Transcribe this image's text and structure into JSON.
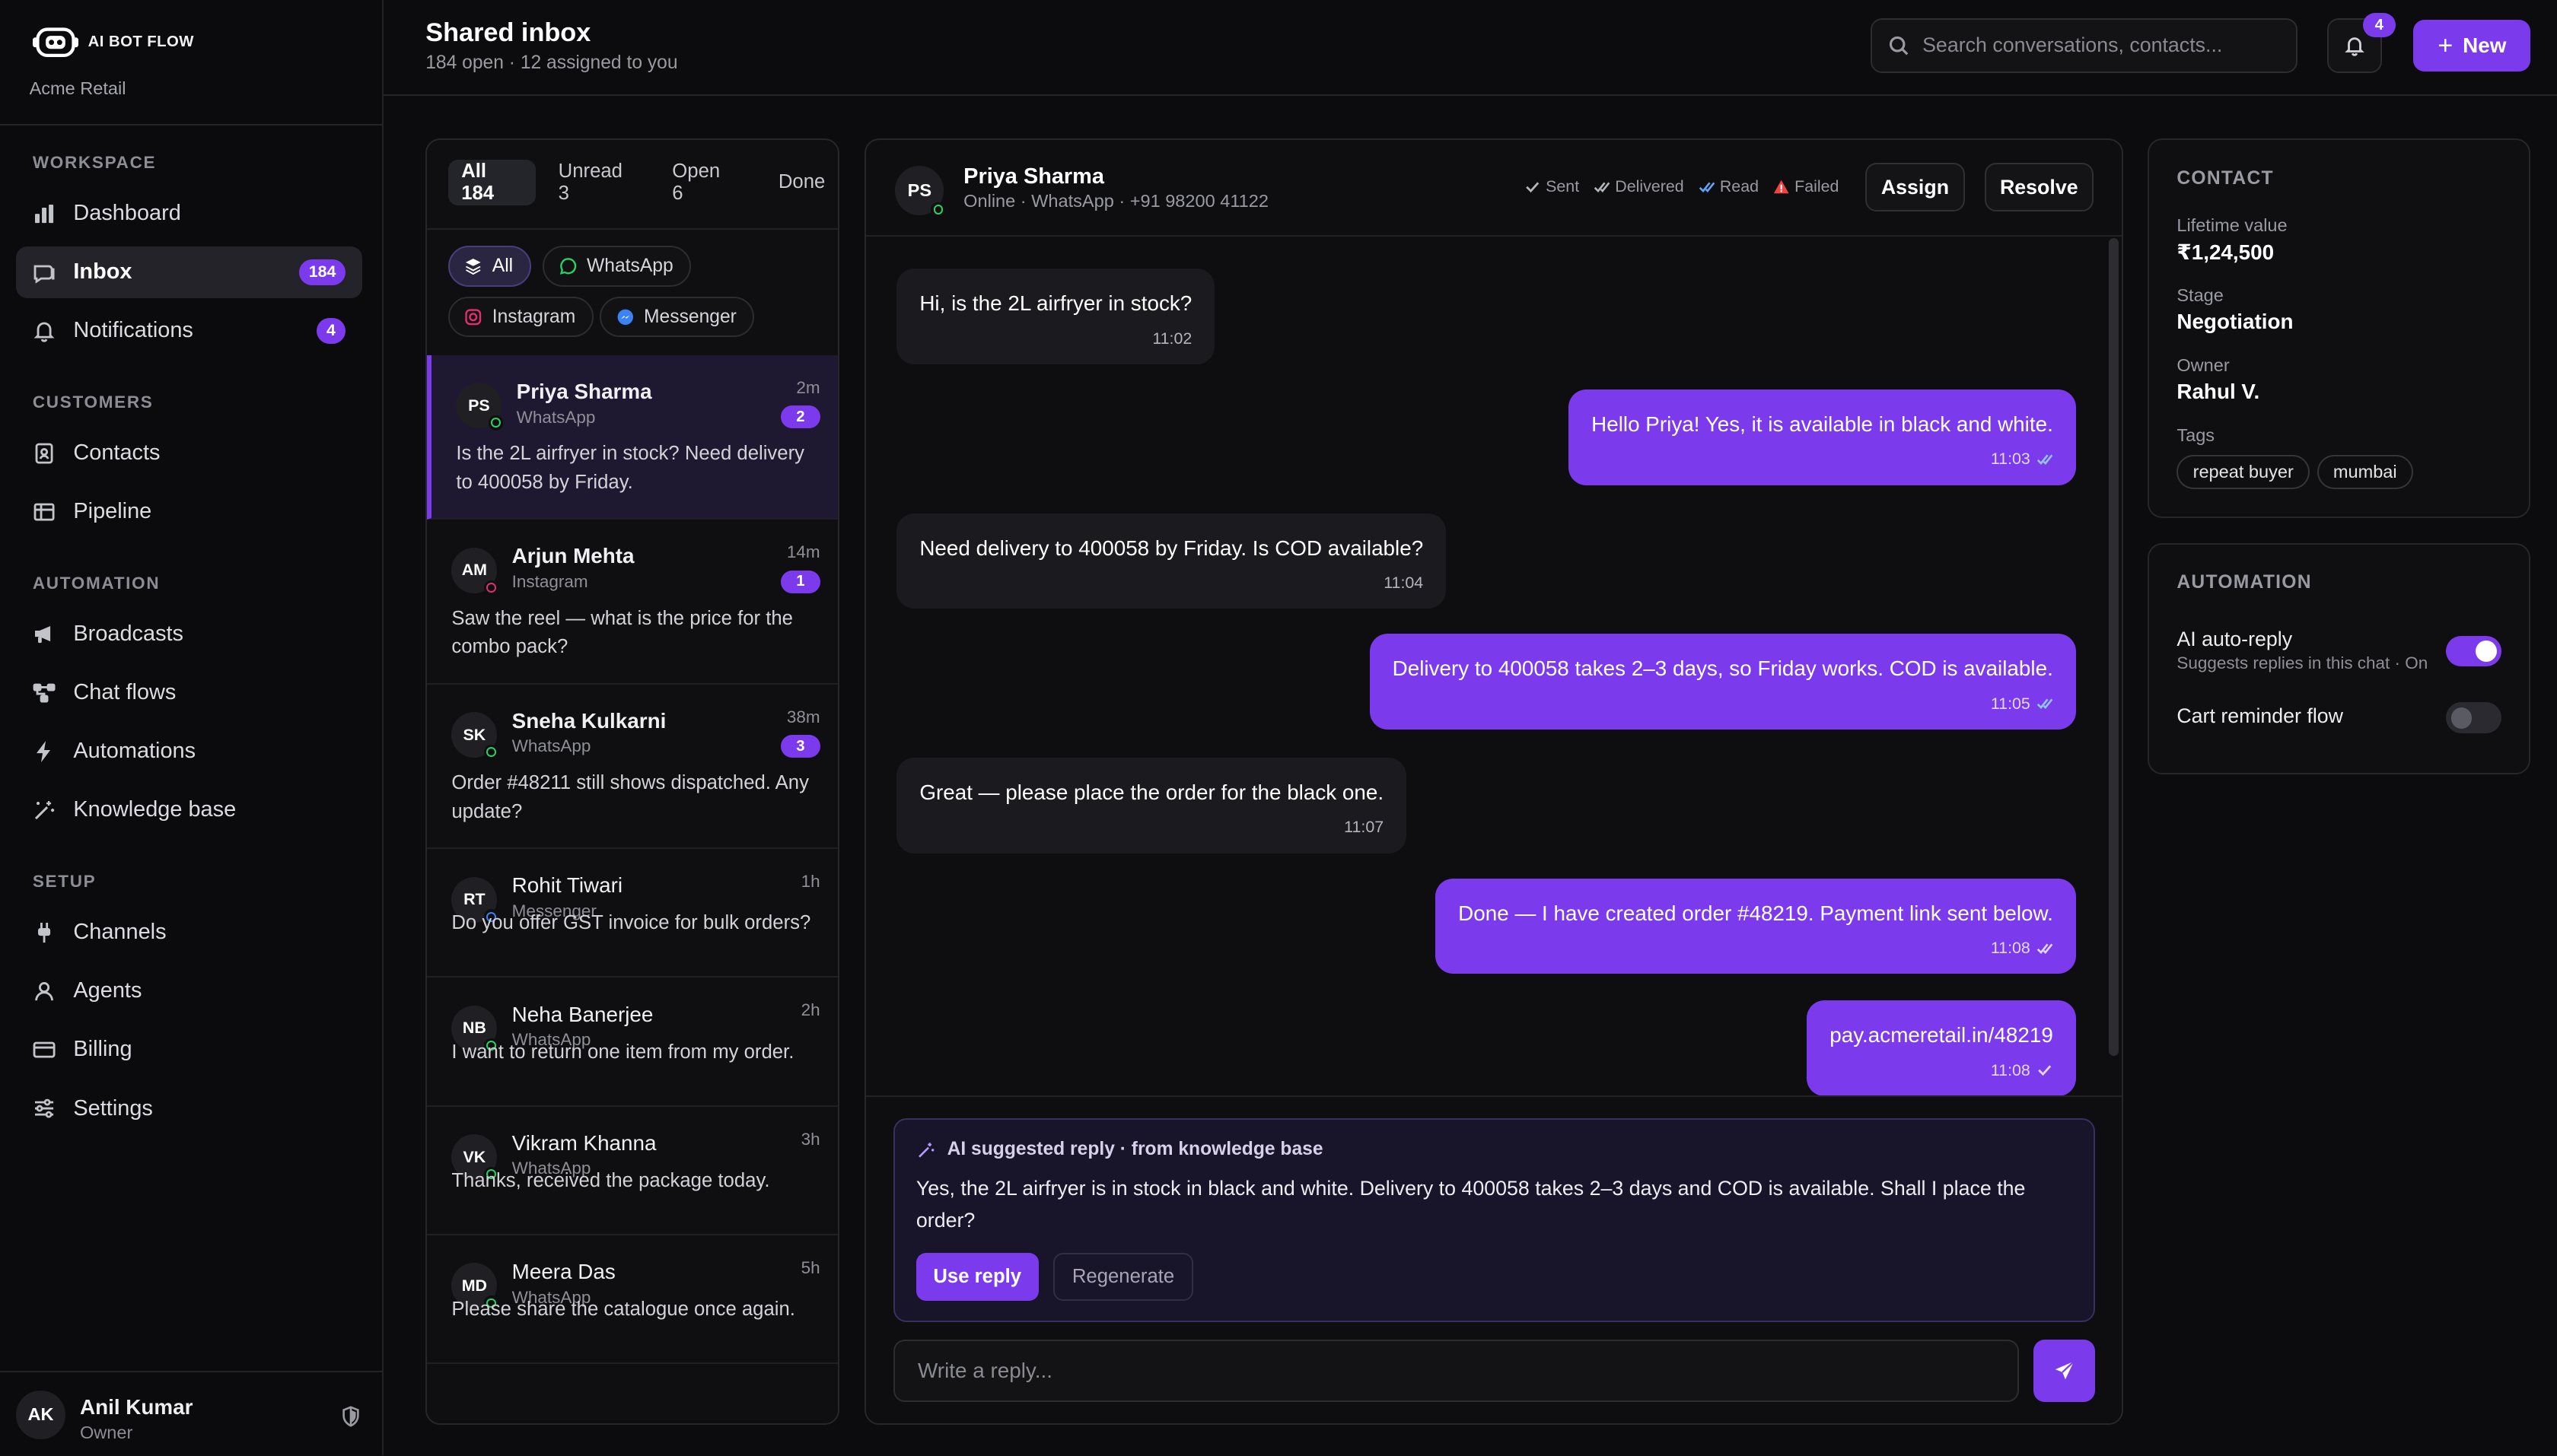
{
  "brand": {
    "name": "AI BOT FLOW",
    "workspace": "Acme Retail"
  },
  "sidebar": {
    "sections": {
      "workspace": "WORKSPACE",
      "customers": "CUSTOMERS",
      "automation": "AUTOMATION",
      "setup": "SETUP"
    },
    "items": [
      {
        "label": "Dashboard",
        "icon": "bar-chart-icon"
      },
      {
        "label": "Inbox",
        "icon": "inbox-icon",
        "badge": "184",
        "active": true
      },
      {
        "label": "Notifications",
        "icon": "bell-icon",
        "badge": "4"
      },
      {
        "label": "Contacts",
        "icon": "contacts-icon"
      },
      {
        "label": "Pipeline",
        "icon": "pipeline-icon"
      },
      {
        "label": "Broadcasts",
        "icon": "megaphone-icon"
      },
      {
        "label": "Chat flows",
        "icon": "flow-icon"
      },
      {
        "label": "Automations",
        "icon": "lightning-icon"
      },
      {
        "label": "Knowledge base",
        "icon": "wand-icon"
      },
      {
        "label": "Channels",
        "icon": "plug-icon"
      },
      {
        "label": "Agents",
        "icon": "user-icon"
      },
      {
        "label": "Billing",
        "icon": "credit-card-icon"
      },
      {
        "label": "Settings",
        "icon": "sliders-icon"
      }
    ],
    "user": {
      "initials": "AK",
      "name": "Anil Kumar",
      "role": "Owner"
    }
  },
  "header": {
    "title": "Shared inbox",
    "subtitle": "184 open · 12 assigned to you",
    "search_placeholder": "Search conversations, contacts...",
    "notif_count": "4",
    "new_label": "New"
  },
  "list": {
    "tabs": [
      "All 184",
      "Unread 3",
      "Open 6",
      "Done"
    ],
    "chips": [
      "All",
      "WhatsApp",
      "Instagram",
      "Messenger"
    ],
    "conversations": [
      {
        "initials": "PS",
        "name": "Priya Sharma",
        "channel": "WhatsApp",
        "time": "2m",
        "unread": "2",
        "preview": "Is the 2L airfryer in stock? Need delivery to 400058 by Friday."
      },
      {
        "initials": "AM",
        "name": "Arjun Mehta",
        "channel": "Instagram",
        "time": "14m",
        "unread": "1",
        "preview": "Saw the reel — what is the price for the combo pack?"
      },
      {
        "initials": "SK",
        "name": "Sneha Kulkarni",
        "channel": "WhatsApp",
        "time": "38m",
        "unread": "3",
        "preview": "Order #48211 still shows dispatched. Any update?"
      },
      {
        "initials": "RT",
        "name": "Rohit Tiwari",
        "channel": "Messenger",
        "time": "1h",
        "preview": "Do you offer GST invoice for bulk orders?"
      },
      {
        "initials": "NB",
        "name": "Neha Banerjee",
        "channel": "WhatsApp",
        "time": "2h",
        "preview": "I want to return one item from my order."
      },
      {
        "initials": "VK",
        "name": "Vikram Khanna",
        "channel": "WhatsApp",
        "time": "3h",
        "preview": "Thanks, received the package today."
      },
      {
        "initials": "MD",
        "name": "Meera Das",
        "channel": "WhatsApp",
        "time": "5h",
        "preview": "Please share the catalogue once again."
      }
    ]
  },
  "chat": {
    "initials": "PS",
    "name": "Priya Sharma",
    "meta": "Online · WhatsApp · +91 98200 41122",
    "legend": {
      "sent": "Sent",
      "delivered": "Delivered",
      "read": "Read",
      "failed": "Failed"
    },
    "assign": "Assign",
    "resolve": "Resolve",
    "messages": [
      {
        "dir": "in",
        "text": "Hi, is the 2L airfryer in stock?",
        "time": "11:02"
      },
      {
        "dir": "out",
        "text": "Hello Priya! Yes, it is available in black and white.",
        "time": "11:03"
      },
      {
        "dir": "in",
        "text": "Need delivery to 400058 by Friday. Is COD available?",
        "time": "11:04"
      },
      {
        "dir": "out",
        "text": "Delivery to 400058 takes 2–3 days, so Friday works. COD is available.",
        "time": "11:05"
      },
      {
        "dir": "in",
        "text": "Great — please place the order for the black one.",
        "time": "11:07"
      },
      {
        "dir": "out",
        "text": "Done — I have created order #48219. Payment link sent below.",
        "time": "11:08"
      },
      {
        "dir": "out",
        "text": "pay.acmeretail.in/48219",
        "time": "11:08"
      }
    ],
    "ai": {
      "title": "AI suggested reply · from knowledge base",
      "text": "Yes, the 2L airfryer is in stock in black and white. Delivery to 400058 takes 2–3 days and COD is available. Shall I place the order?",
      "use": "Use reply",
      "regen": "Regenerate"
    },
    "reply_placeholder": "Write a reply..."
  },
  "contact": {
    "title": "CONTACT",
    "lifetime_label": "Lifetime value",
    "lifetime": "₹1,24,500",
    "stage_label": "Stage",
    "stage": "Negotiation",
    "owner_label": "Owner",
    "owner": "Rahul V.",
    "tags_label": "Tags",
    "tags": [
      "repeat buyer",
      "mumbai"
    ]
  },
  "automation": {
    "title": "AUTOMATION",
    "ai_label": "AI auto-reply",
    "ai_sub": "Suggests replies in this chat · On",
    "ai_on": true,
    "cart_label": "Cart reminder flow",
    "cart_on": false
  },
  "colors": {
    "accent": "#7c3aed",
    "whatsapp": "#25d366",
    "instagram": "#e1306c",
    "messenger": "#3b82f6",
    "failed": "#ef4444",
    "read": "#60a5fa"
  }
}
